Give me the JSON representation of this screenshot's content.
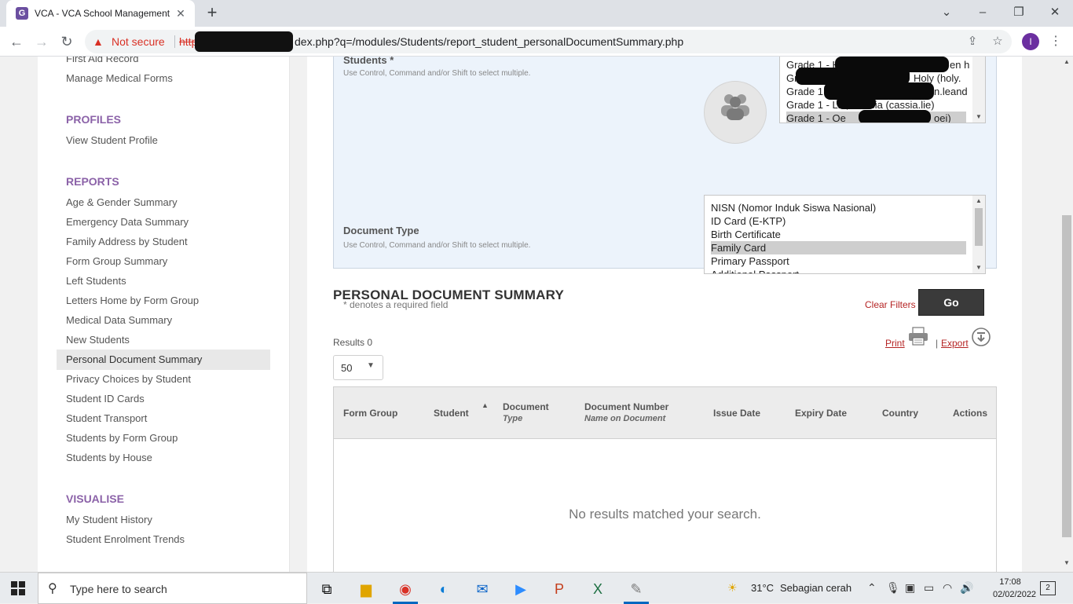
{
  "browser": {
    "tab_title": "VCA - VCA School Management",
    "tab_favicon": "G",
    "new_tab": "+",
    "not_secure": "Not secure",
    "url_scheme": "http",
    "url_visible": "dex.php?q=/modules/Students/report_student_personalDocumentSummary.php",
    "profile_initial": "I"
  },
  "sidebar": {
    "top_items": [
      "First Aid Record",
      "Manage Medical Forms"
    ],
    "profiles_heading": "PROFILES",
    "profiles_items": [
      "View Student Profile"
    ],
    "reports_heading": "REPORTS",
    "reports_items": [
      "Age & Gender Summary",
      "Emergency Data Summary",
      "Family Address by Student",
      "Form Group Summary",
      "Left Students",
      "Letters Home by Form Group",
      "Medical Data Summary",
      "New Students",
      "Personal Document Summary",
      "Privacy Choices by Student",
      "Student ID Cards",
      "Student Transport",
      "Students by Form Group",
      "Students by House"
    ],
    "active_item": "Personal Document Summary",
    "visualise_heading": "VISUALISE",
    "visualise_items": [
      "My Student History",
      "Student Enrolment Trends"
    ]
  },
  "filter": {
    "students_label": "Students *",
    "students_help": "Use Control, Command and/or Shift to select multiple.",
    "students_options": [
      "Grade 1 - H",
      "Grade 1 -",
      "Grade 1 -",
      "Grade 1 - Lie, Cassia (cassia.lie)",
      "Grade 1 - Oe"
    ],
    "students_visible_fragments": {
      "frag1": "en h",
      "frag2": "Holy (holy.",
      "frag3": "n.leand",
      "frag4": "oei)"
    },
    "document_type_label": "Document Type",
    "document_type_help": "Use Control, Command and/or Shift to select multiple.",
    "document_type_options": [
      "NISN (Nomor Induk Siswa Nasional)",
      "ID Card (E-KTP)",
      "Birth Certificate",
      "Family Card",
      "Primary Passport",
      "Additional Passport"
    ],
    "document_type_selected": "Family Card",
    "required_note": "* denotes a required field",
    "clear_filters": "Clear Filters",
    "go": "Go"
  },
  "report": {
    "title": "PERSONAL DOCUMENT SUMMARY",
    "results": "Results 0",
    "page_size": "50",
    "print": "Print",
    "pipe": "|",
    "export": "Export",
    "columns": {
      "form_group": "Form Group",
      "student": "Student",
      "document": "Document",
      "document_sub": "Type",
      "document_number": "Document Number",
      "document_number_sub": "Name on Document",
      "issue_date": "Issue Date",
      "expiry_date": "Expiry Date",
      "country": "Country",
      "actions": "Actions"
    },
    "empty_message": "No results matched your search."
  },
  "taskbar": {
    "search_placeholder": "Type here to search",
    "weather_temp": "31°C",
    "weather_text": "Sebagian cerah",
    "time": "17:08",
    "date": "02/02/2022",
    "notifications": "2"
  },
  "colors": {
    "accent_purple": "#8b62a8",
    "link_red": "#b52424",
    "go_button": "#3a3a3a",
    "filter_bg": "#ecf3fb"
  }
}
